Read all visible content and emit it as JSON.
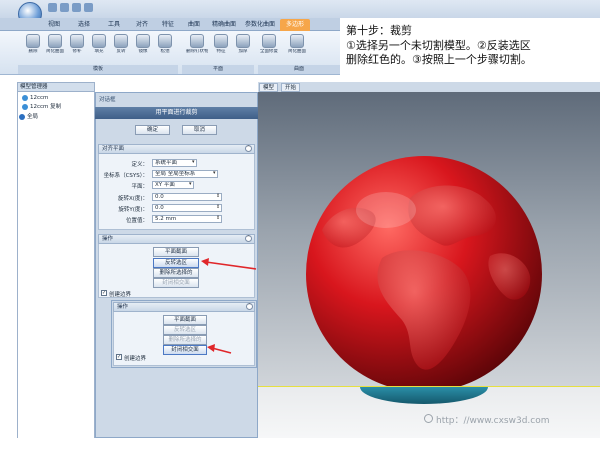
{
  "ribbon": {
    "tabs": [
      "视图",
      "选择",
      "工具",
      "对齐",
      "特征",
      "曲面",
      "精确曲面",
      "参数化曲面",
      "多边形"
    ],
    "active_tab": "多边形",
    "tools": [
      "删除",
      "简化曲面",
      "修补",
      "填充",
      "反转",
      "镜像",
      "松弛",
      "删除钉状物",
      "特征",
      "加厚",
      "全面修复",
      "简化曲面"
    ],
    "groups": [
      "模板",
      "平面",
      "曲面"
    ]
  },
  "annotation": {
    "title": "第十步：裁剪",
    "line1": "①选择另一个未切割模型。②反装选区",
    "line2": "删除红色的。③按照上一个步骤切割。"
  },
  "model_manager": {
    "title": "模型管理器",
    "items": [
      "12ccm",
      "12ccm 复制",
      "全局"
    ]
  },
  "dialog": {
    "label": "对话框",
    "title": "用平面进行裁剪",
    "ok": "确定",
    "cancel": "取消",
    "align_section": "对齐平面",
    "fields": [
      {
        "label": "定义：",
        "value": "系统平面"
      },
      {
        "label": "坐标系（CSYS）：",
        "value": "全局 全局坐标系"
      },
      {
        "label": "平面：",
        "value": "XY 平面"
      },
      {
        "label": "旋转X(度)：",
        "value": "0.0"
      },
      {
        "label": "旋转Y(度)：",
        "value": "0.0"
      },
      {
        "label": "位置值：",
        "value": "5.2 mm"
      }
    ],
    "operation_section": "操作",
    "operation_buttons": [
      "平面截面",
      "反转选区",
      "删除所选择的",
      "封闭相交面"
    ],
    "create_border": "创建边界",
    "operation2_section": "操作",
    "operation2_buttons": [
      "平面截面",
      "反转选区",
      "删除所选择的",
      "封闭相交面"
    ],
    "create_border2": "创建边界"
  },
  "viewport": {
    "tabs": [
      "模型",
      "开始"
    ]
  },
  "watermark": "http：//www.cxsw3d.com"
}
